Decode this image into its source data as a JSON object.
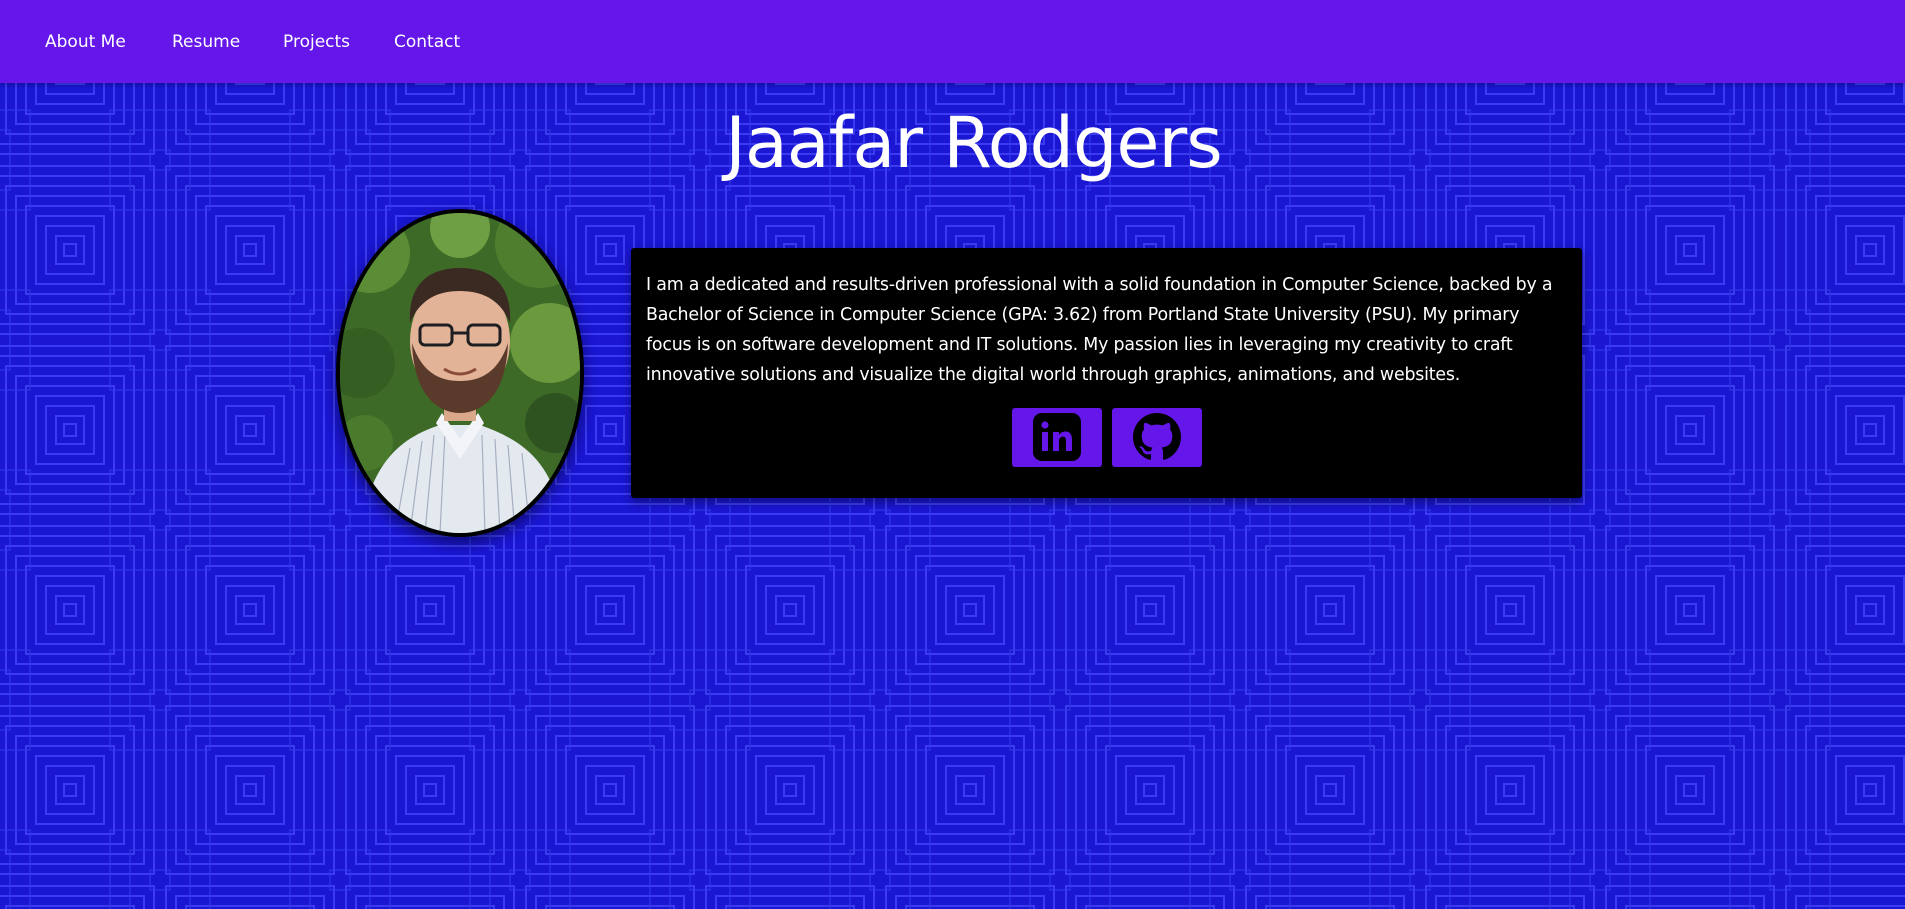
{
  "nav": {
    "items": [
      {
        "label": "About Me"
      },
      {
        "label": "Resume"
      },
      {
        "label": "Projects"
      },
      {
        "label": "Contact"
      }
    ]
  },
  "hero": {
    "name": "Jaafar Rodgers",
    "bio": "I am a dedicated and results-driven professional with a solid foundation in Computer Science, backed by a Bachelor of Science in Computer Science (GPA: 3.62) from Portland State University (PSU). My primary focus is on software development and IT solutions. My passion lies in leveraging my creativity to craft innovative solutions and visualize the digital world through graphics, animations, and websites."
  },
  "social": {
    "links": [
      {
        "icon": "linkedin-icon"
      },
      {
        "icon": "github-icon"
      }
    ]
  },
  "colors": {
    "navbar": "#6417e8",
    "background": "#1a16d2",
    "pattern_line": "#3b3cf2",
    "card": "#000000",
    "social_button": "#6417e8",
    "text": "#ffffff"
  }
}
